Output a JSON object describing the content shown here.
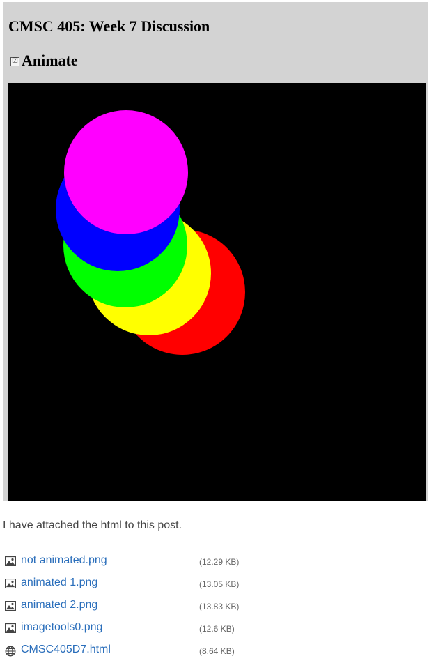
{
  "embed": {
    "title": "CMSC 405: Week 7 Discussion",
    "animate_checkbox": {
      "checked": true,
      "label": "Animate",
      "glyph": "☑"
    },
    "canvas": {
      "background": "#000000",
      "circle_colors": [
        "#ff0000",
        "#ffff00",
        "#00ff00",
        "#0000ff",
        "#ff00ff"
      ]
    }
  },
  "post": {
    "text": "I have attached the html to this post."
  },
  "attachments": [
    {
      "icon": "image-file-icon",
      "name": "not animated.png",
      "size": "(12.29 KB)"
    },
    {
      "icon": "image-file-icon",
      "name": "animated 1.png",
      "size": "(13.05 KB)"
    },
    {
      "icon": "image-file-icon",
      "name": "animated 2.png",
      "size": "(13.83 KB)"
    },
    {
      "icon": "image-file-icon",
      "name": "imagetools0.png",
      "size": "(12.6 KB)"
    },
    {
      "icon": "globe-icon",
      "name": "CMSC405D7.html",
      "size": "(8.64 KB)"
    }
  ],
  "colors": {
    "link": "#2a6ebb",
    "frame_background": "#d3d3d3",
    "muted_text": "#666666"
  }
}
